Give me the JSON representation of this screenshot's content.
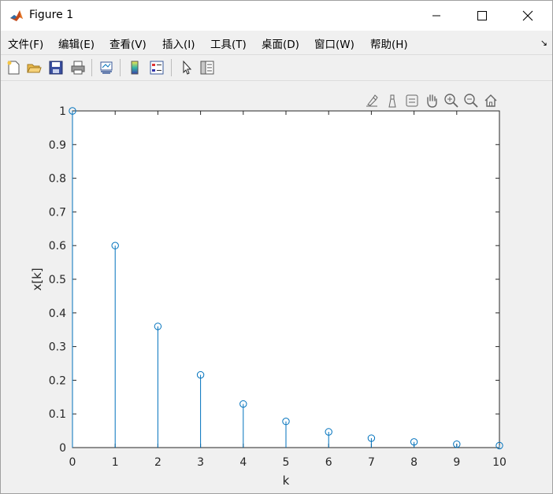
{
  "window": {
    "title": "Figure 1"
  },
  "menu": [
    "文件(F)",
    "编辑(E)",
    "查看(V)",
    "插入(I)",
    "工具(T)",
    "桌面(D)",
    "窗口(W)",
    "帮助(H)"
  ],
  "icons": {
    "toolbar": [
      "new-figure-icon",
      "open-file-icon",
      "save-icon",
      "print-icon",
      "link-plot-icon",
      "colorbar-icon",
      "legend-icon",
      "pointer-icon",
      "property-inspector-icon"
    ],
    "axes_toolbar": [
      "brush-icon",
      "data-cursor-icon",
      "edit-plot-icon",
      "pan-icon",
      "zoom-in-icon",
      "zoom-out-icon",
      "restore-view-icon"
    ]
  },
  "colors": {
    "series": "#0072bd",
    "axes": "#262626",
    "figure_bg": "#f0f0f0"
  },
  "chart_data": {
    "type": "stem",
    "x": [
      0,
      1,
      2,
      3,
      4,
      5,
      6,
      7,
      8,
      9,
      10
    ],
    "y": [
      1,
      0.6,
      0.36,
      0.216,
      0.1296,
      0.0778,
      0.0467,
      0.028,
      0.0168,
      0.0101,
      0.006
    ],
    "xlabel": "k",
    "ylabel": "x[k]",
    "xlim": [
      0,
      10
    ],
    "ylim": [
      0,
      1
    ],
    "xticks": [
      "0",
      "1",
      "2",
      "3",
      "4",
      "5",
      "6",
      "7",
      "8",
      "9",
      "10"
    ],
    "yticks": [
      "0",
      "0.1",
      "0.2",
      "0.3",
      "0.4",
      "0.5",
      "0.6",
      "0.7",
      "0.8",
      "0.9",
      "1"
    ],
    "marker": "circle",
    "grid": false
  }
}
